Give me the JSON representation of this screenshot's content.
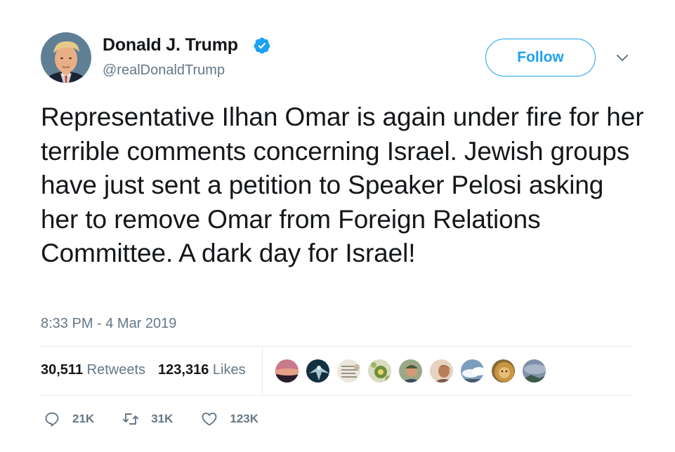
{
  "user": {
    "display_name": "Donald J. Trump",
    "handle": "@realDonaldTrump",
    "verified": true
  },
  "follow_button": {
    "label": "Follow"
  },
  "tweet": {
    "text": "Representative Ilhan Omar is again under fire for her terrible comments concerning Israel. Jewish groups have just sent a petition to Speaker Pelosi asking her to remove Omar from Foreign Relations Committee. A dark day for Israel!",
    "timestamp": "8:33 PM - 4 Mar 2019"
  },
  "stats": {
    "retweets_count": "30,511",
    "retweets_label": "Retweets",
    "likes_count": "123,316",
    "likes_label": "Likes"
  },
  "liked_by_avatars": [
    {
      "icon": "liker-avatar-sunset",
      "color": "#8a4a5e"
    },
    {
      "icon": "liker-avatar-eagle",
      "color": "#1f3a4a"
    },
    {
      "icon": "liker-avatar-document",
      "color": "#e4ded2"
    },
    {
      "icon": "liker-avatar-floral",
      "color": "#8fa766"
    },
    {
      "icon": "liker-avatar-man",
      "color": "#7d8a6a"
    },
    {
      "icon": "liker-avatar-person",
      "color": "#b89a7a"
    },
    {
      "icon": "liker-avatar-clouds",
      "color": "#b7c7d8"
    },
    {
      "icon": "liker-avatar-lion",
      "color": "#c39a5a"
    },
    {
      "icon": "liker-avatar-sky",
      "color": "#6f7f98"
    }
  ],
  "actions": {
    "reply_count": "21K",
    "retweet_count": "31K",
    "like_count": "123K"
  },
  "colors": {
    "accent": "#1da1f2",
    "secondary_text": "#657786",
    "divider": "#e6ecf0"
  }
}
